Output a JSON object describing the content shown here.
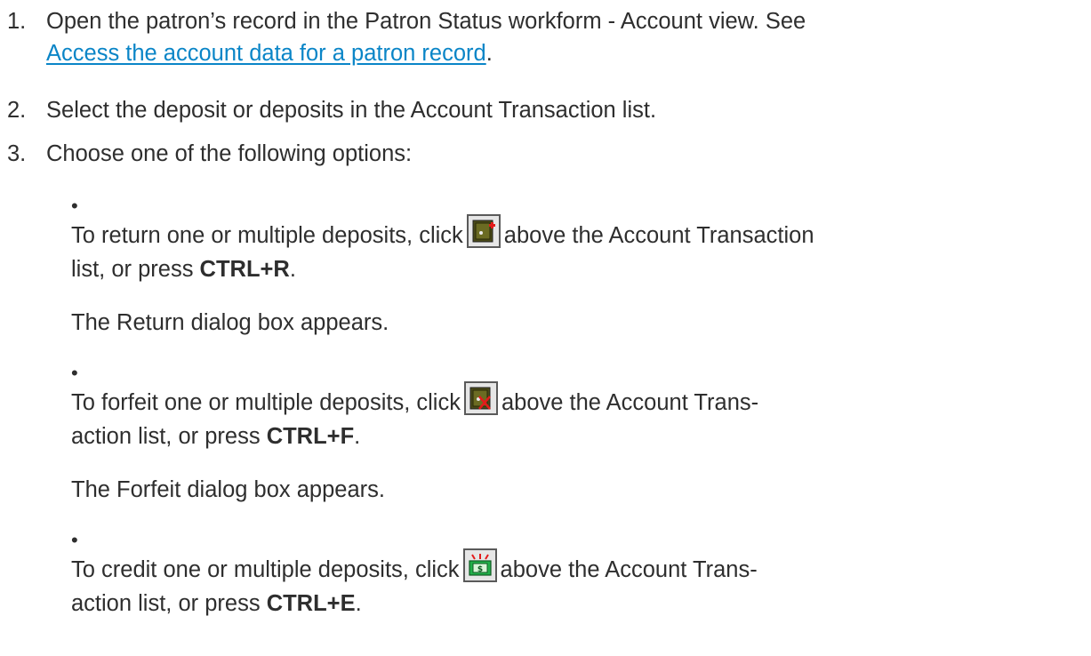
{
  "steps": [
    {
      "num": "1.",
      "text_before": "Open the patron’s record in the Patron Status workform - Account view. See",
      "link": "Access the account data for a patron record",
      "text_after": "."
    },
    {
      "num": "2.",
      "text": "Select the deposit or deposits in the Account Transaction list."
    },
    {
      "num": "3.",
      "text": "Choose one of the following options:"
    }
  ],
  "options": [
    {
      "bullet": "•",
      "before": "To return one or multiple deposits, click",
      "after_line1": "above the Account Transaction",
      "line2_prefix": "list, or press",
      "shortcut": "CTRL+R",
      "line2_suffix": ".",
      "result": "The Return dialog box appears.",
      "icon": "return-deposit-icon"
    },
    {
      "bullet": "•",
      "before": "To forfeit one or multiple deposits, click",
      "after_line1": "above the Account Trans-",
      "line2_prefix": "action list, or press",
      "shortcut": "CTRL+F",
      "line2_suffix": ".",
      "result": "The Forfeit dialog box appears.",
      "icon": "forfeit-deposit-icon"
    },
    {
      "bullet": "•",
      "before": "To credit one or multiple deposits, click",
      "after_line1": "above the Account Trans-",
      "line2_prefix": "action list, or press",
      "shortcut": "CTRL+E",
      "line2_suffix": ".",
      "icon": "credit-deposit-icon"
    }
  ],
  "colors": {
    "text": "#2e2e2e",
    "link": "#0a85c7"
  }
}
